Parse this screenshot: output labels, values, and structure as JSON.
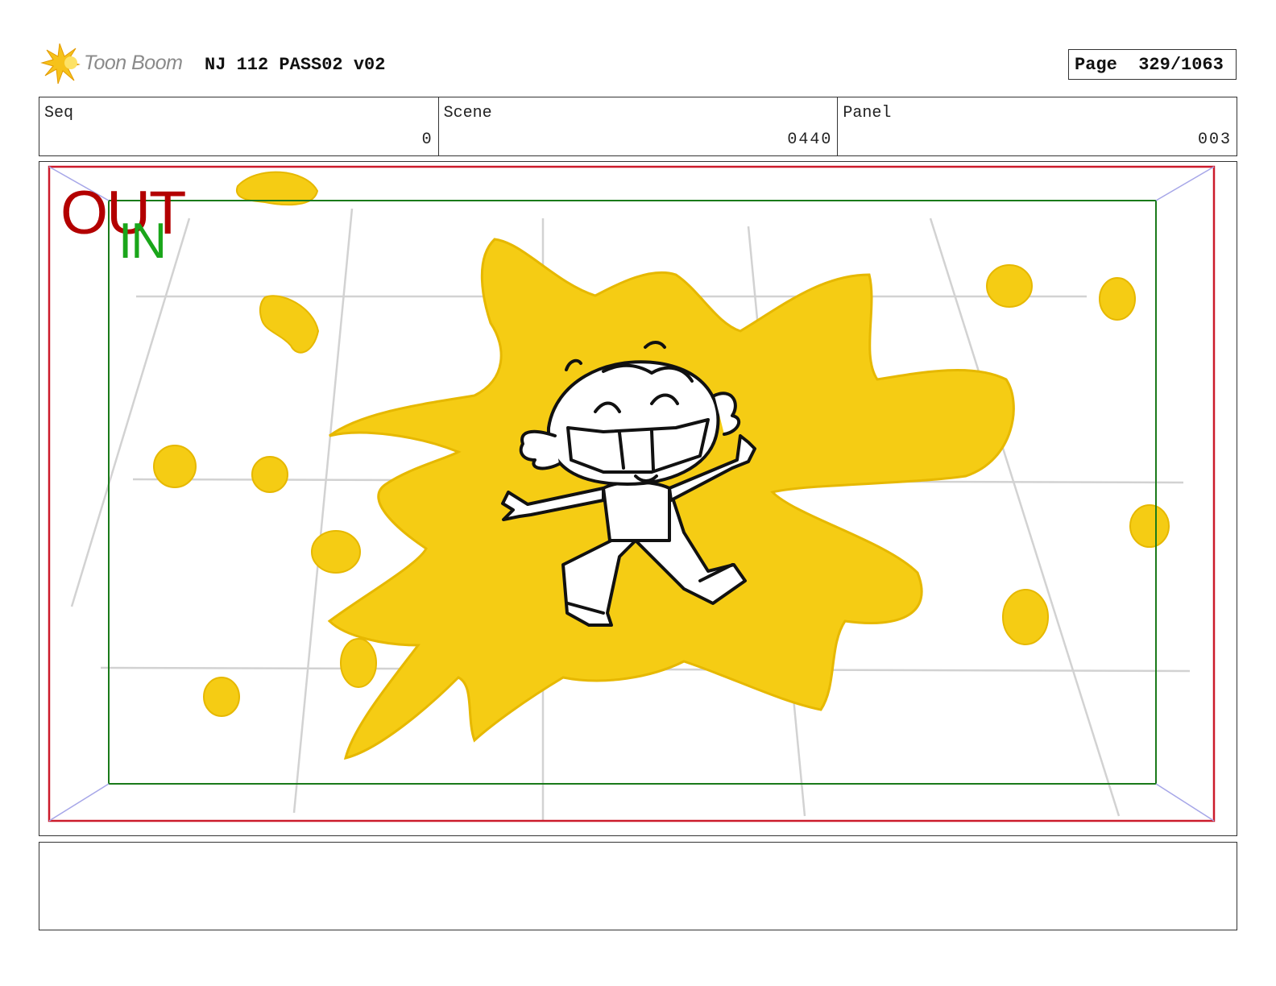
{
  "header": {
    "logo_text": "Toon Boom",
    "title": "NJ 112 PASS02 v02",
    "page_label": "Page",
    "page_value": "329/1063"
  },
  "meta": {
    "seq_label": "Seq",
    "seq_value": "0",
    "scene_label": "Scene",
    "scene_value": "0440",
    "panel_label": "Panel",
    "panel_value": "003"
  },
  "panel": {
    "out_label": "OUT",
    "in_label": "IN",
    "out_frame_color": "#cc1b2b",
    "in_frame_color": "#1a7a1a",
    "splat_color": "#f5cc14"
  },
  "notes": {
    "text": ""
  }
}
